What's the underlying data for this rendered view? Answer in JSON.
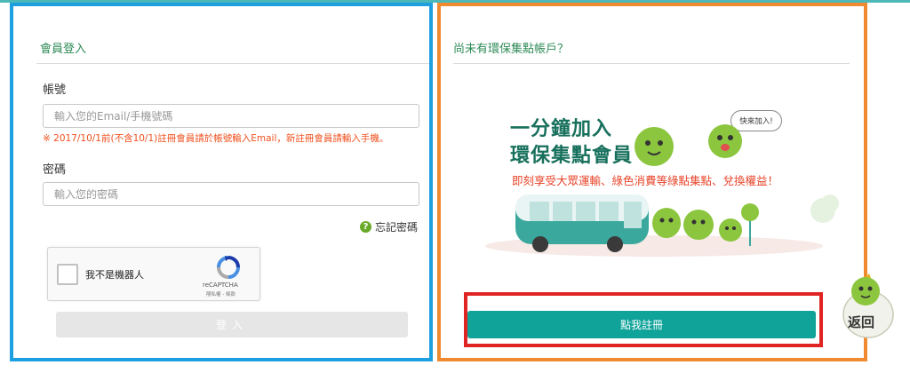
{
  "login": {
    "title": "會員登入",
    "account_label": "帳號",
    "account_placeholder": "輸入您的Email/手機號碼",
    "notice": "※ 2017/10/1前(不含10/1)註冊會員請於帳號輸入Email，新註冊會員請輸入手機。",
    "password_label": "密碼",
    "password_placeholder": "輸入您的密碼",
    "forgot_label": "忘記密碼",
    "captcha": {
      "text": "我不是機器人",
      "brand": "reCAPTCHA",
      "links": "隱私權 - 條款"
    },
    "submit_label": "登入"
  },
  "register": {
    "title": "尚未有環保集點帳戶？",
    "promo_line1": "一分鐘加入",
    "promo_line2": "環保集點會員",
    "promo_sub": "即刻享受大眾運輸、綠色消費等綠點集點、兌換權益！",
    "bubble": "快來加入!",
    "button_label": "點我註冊"
  },
  "back_label": "返回",
  "colors": {
    "login_frame": "#1ea0e0",
    "register_frame": "#f08a30",
    "register_button_frame": "#e02424",
    "accent_teal": "#0fa39a",
    "title_green": "#2e8b57",
    "notice_orange": "#f0501e"
  },
  "icons": [
    "question-icon",
    "recaptcha-logo-icon",
    "mascot-icon",
    "bus-icon"
  ]
}
